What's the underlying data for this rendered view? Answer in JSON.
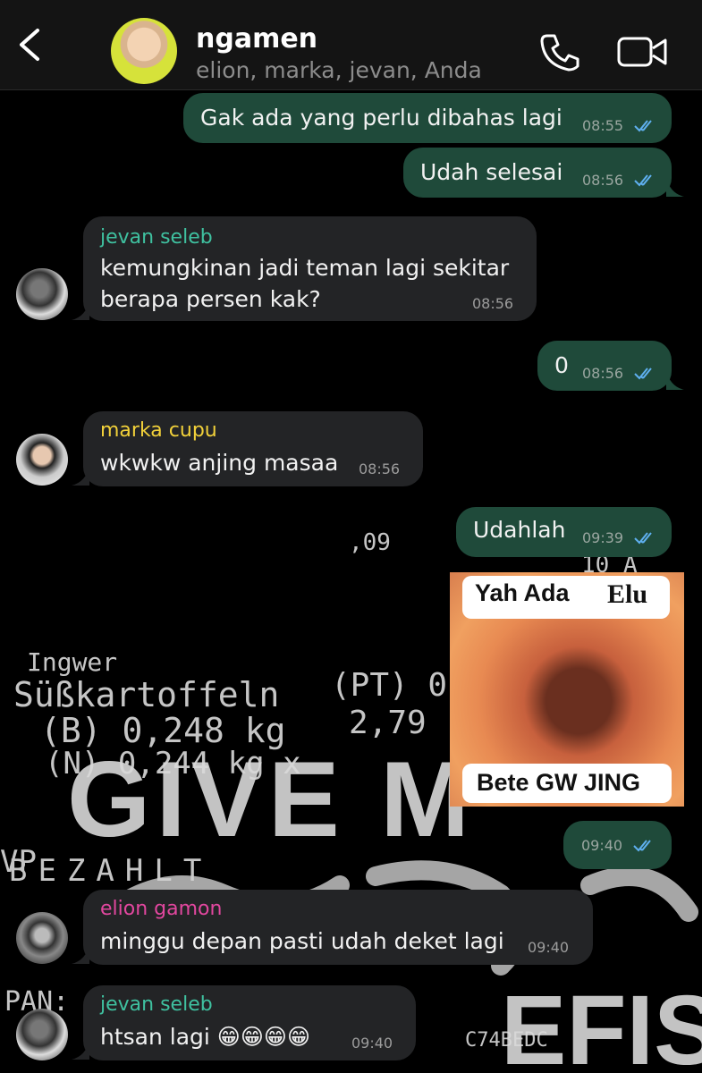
{
  "header": {
    "title": "ngamen",
    "members": "elion, marka, jevan, Anda",
    "back_icon": "chevron-left-icon",
    "call_icon": "phone-icon",
    "video_icon": "video-camera-icon"
  },
  "messages": [
    {
      "dir": "out",
      "text": "Gak ada yang perlu dibahas lagi",
      "time": "08:55",
      "status": "read"
    },
    {
      "dir": "out",
      "text": "Udah selesai",
      "time": "08:56",
      "status": "read"
    },
    {
      "dir": "in",
      "sender": "jevan seleb",
      "sender_color": "#3fc1a0",
      "lines": [
        "kemungkinan jadi teman lagi sekitar",
        "berapa persen kak?"
      ],
      "time": "08:56"
    },
    {
      "dir": "out",
      "text": "0",
      "time": "08:56",
      "status": "read"
    },
    {
      "dir": "in",
      "sender": "marka cupu",
      "sender_color": "#f2d13a",
      "text": "wkwkw anjing masaa",
      "time": "08:56"
    },
    {
      "dir": "out",
      "text": "Udahlah",
      "time": "09:39",
      "status": "read"
    },
    {
      "dir": "out",
      "type": "image",
      "caption_top_left": "Yah Ada",
      "caption_top_right": "Elu",
      "caption_bottom": "Bete GW JING",
      "time": "09:40",
      "status": "read"
    },
    {
      "dir": "in",
      "sender": "elion gamon",
      "sender_color": "#e2479f",
      "text": "minggu depan pasti udah deket lagi",
      "time": "09:40"
    },
    {
      "dir": "in",
      "sender": "jevan seleb",
      "sender_color": "#3fc1a0",
      "text": "htsan lagi 😁😁😁😁",
      "time": "09:40"
    }
  ],
  "wallpaper": {
    "line1": "Ingwer",
    "line2": "Süßkartoffeln",
    "line3": "(B) 0,248 kg",
    "line4": "(N) 0,244 kg x",
    "line5": "(PT) 0,",
    "line6": "2,79",
    "big": "GIVE M",
    "line7": "BEZAHLT",
    "line8": "VP",
    "line9": "PAN:",
    "line10": "C74BEDC",
    "big2": "EFIS",
    "top": ",09",
    "top2": "10 A"
  },
  "colors": {
    "outgoing_bubble": "#1f4a3a",
    "incoming_bubble": "#232426",
    "tick_read": "#5fb0f0"
  }
}
